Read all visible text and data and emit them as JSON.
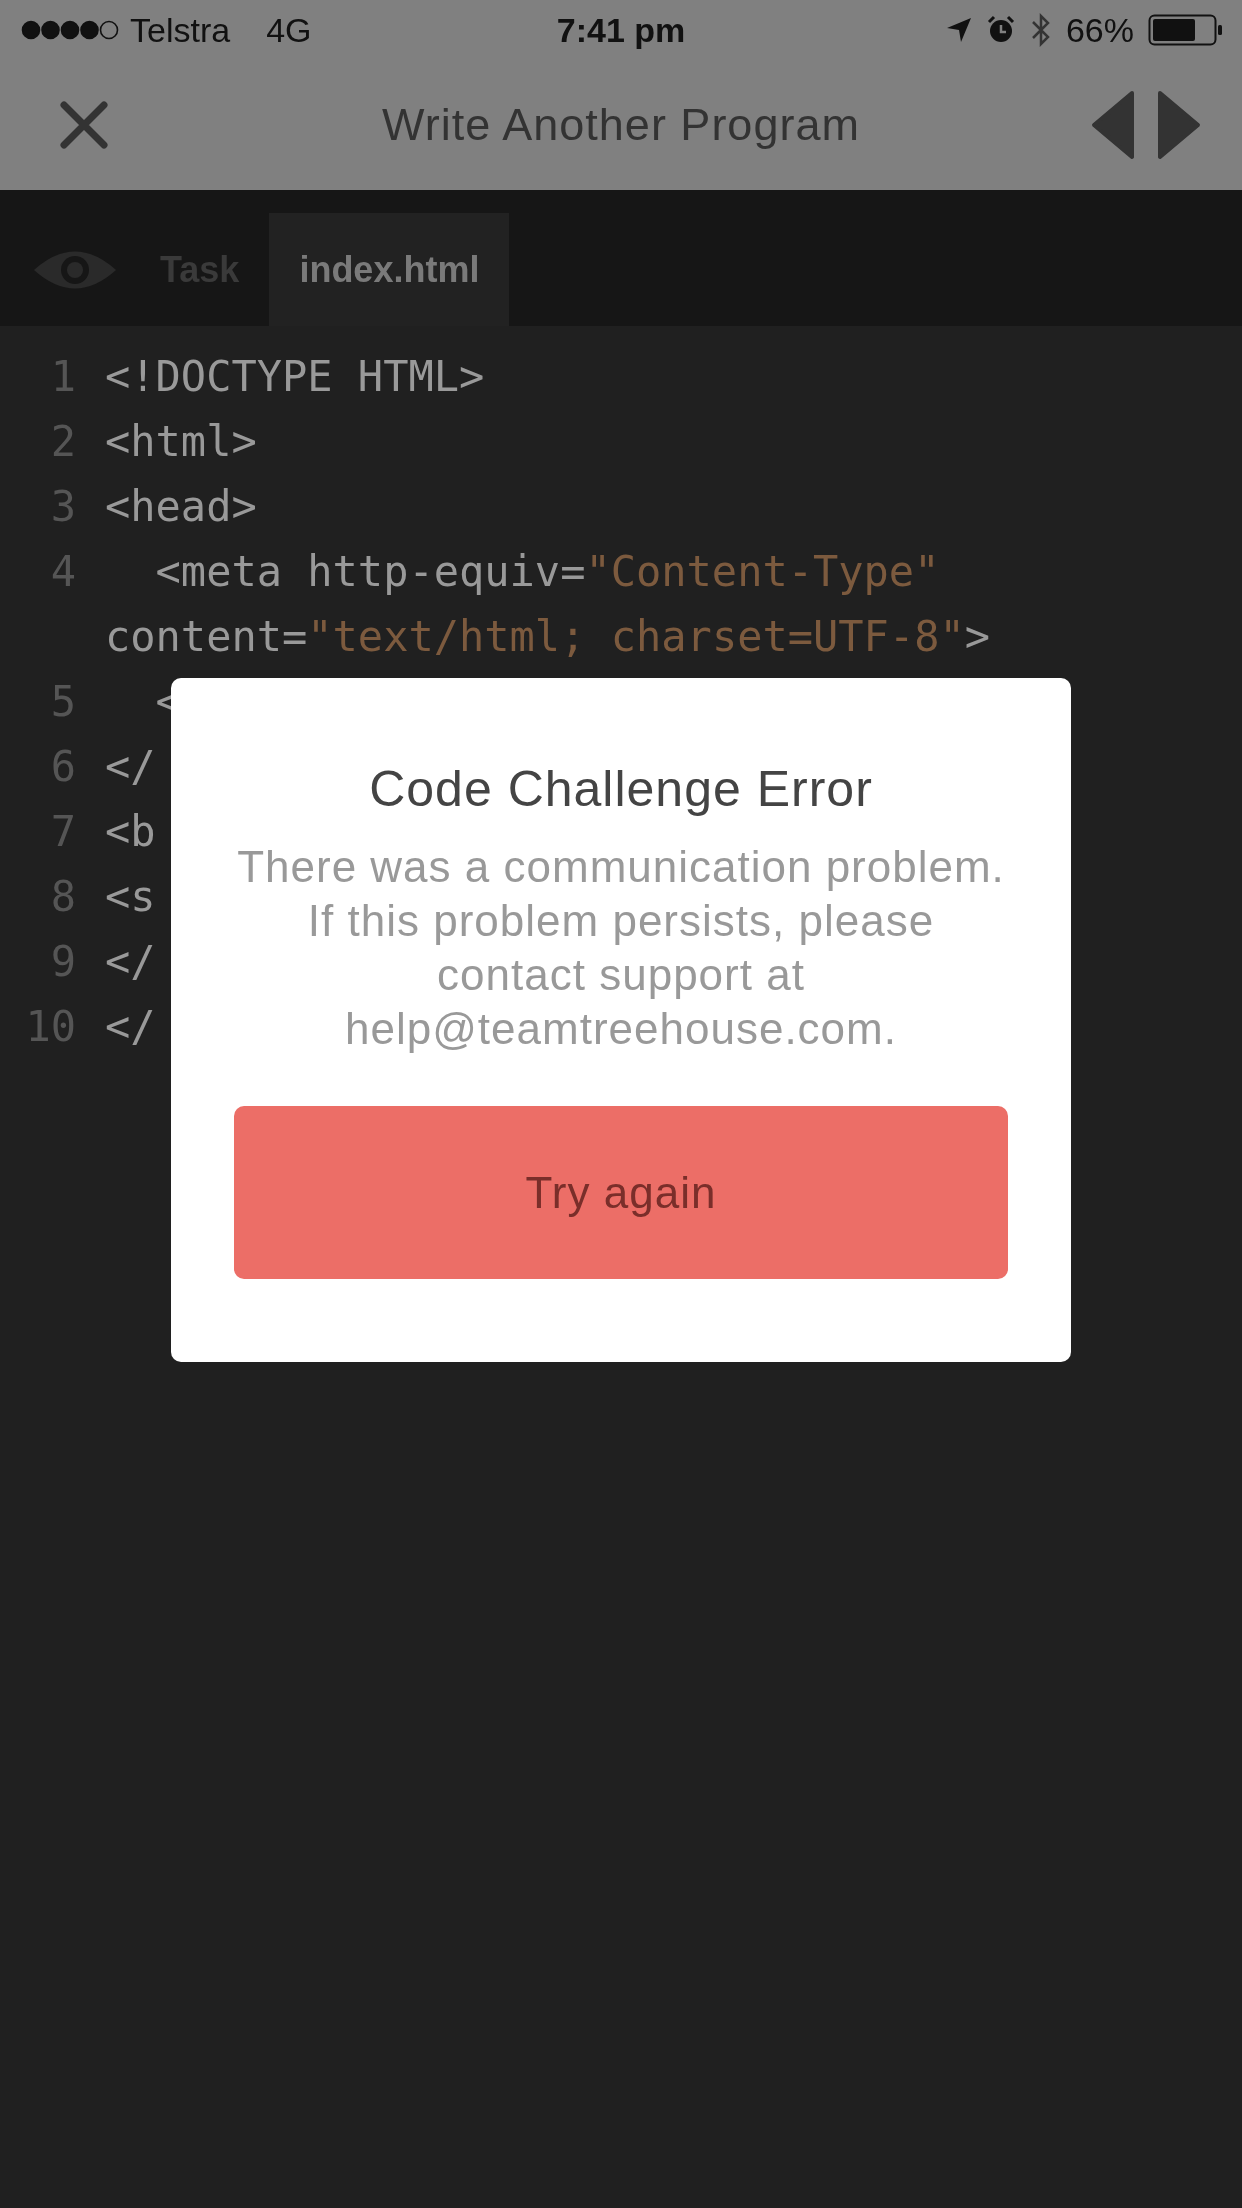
{
  "status_bar": {
    "carrier": "Telstra",
    "network": "4G",
    "time": "7:41 pm",
    "battery": "66%"
  },
  "nav": {
    "title": "Write Another Program"
  },
  "tabs": [
    {
      "label": "Task",
      "selected": false
    },
    {
      "label": "index.html",
      "selected": true
    }
  ],
  "code": {
    "rows": [
      {
        "number": "1",
        "segments": [
          {
            "kind": "plain",
            "text": "<!DOCTYPE HTML>"
          }
        ]
      },
      {
        "number": "2",
        "segments": [
          {
            "kind": "plain",
            "text": "<html>"
          }
        ]
      },
      {
        "number": "3",
        "segments": [
          {
            "kind": "plain",
            "text": "<head>"
          }
        ]
      },
      {
        "number": "4",
        "segments": [
          {
            "kind": "plain",
            "text": "  <meta http-equiv="
          },
          {
            "kind": "string",
            "text": "\"Content-Type\""
          }
        ]
      },
      {
        "segments": [
          {
            "kind": "plain",
            "text": "content="
          },
          {
            "kind": "string",
            "text": "\"text/html; charset=UTF-8\""
          },
          {
            "kind": "plain",
            "text": ">"
          }
        ]
      },
      {
        "number": "5",
        "segments": [
          {
            "kind": "plain",
            "text": "  <"
          }
        ]
      },
      {
        "number": "6",
        "segments": [
          {
            "kind": "plain",
            "text": "</"
          }
        ]
      },
      {
        "number": "7",
        "segments": [
          {
            "kind": "plain",
            "text": "<b"
          }
        ]
      },
      {
        "number": "8",
        "segments": [
          {
            "kind": "plain",
            "text": "<s"
          }
        ]
      },
      {
        "number": "9",
        "segments": [
          {
            "kind": "plain",
            "text": "</"
          }
        ]
      },
      {
        "number": "10",
        "segments": [
          {
            "kind": "plain",
            "text": "</"
          }
        ]
      }
    ]
  },
  "dialog": {
    "title": "Code Challenge Error",
    "message": "There was a communication problem. If this problem persists, please contact support at help@teamtreehouse.com.",
    "button": "Try again"
  }
}
